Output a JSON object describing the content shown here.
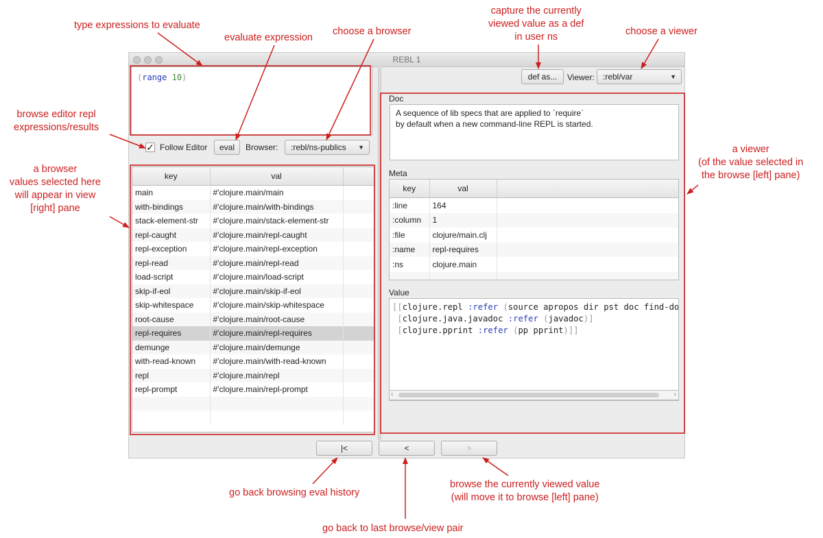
{
  "window": {
    "title": "REBL 1"
  },
  "editor": {
    "paren_open": "(",
    "fn": "range",
    "arg": "10",
    "paren_close": ")"
  },
  "controls": {
    "follow_editor_label": "Follow Editor",
    "follow_editor_checked": true,
    "eval_label": "eval",
    "browser_label": "Browser:",
    "browser_value": ":rebl/ns-publics"
  },
  "browse_table": {
    "columns": [
      "key",
      "val"
    ],
    "selected_index": 10,
    "rows": [
      [
        "main",
        "#'clojure.main/main"
      ],
      [
        "with-bindings",
        "#'clojure.main/with-bindings"
      ],
      [
        "stack-element-str",
        "#'clojure.main/stack-element-str"
      ],
      [
        "repl-caught",
        "#'clojure.main/repl-caught"
      ],
      [
        "repl-exception",
        "#'clojure.main/repl-exception"
      ],
      [
        "repl-read",
        "#'clojure.main/repl-read"
      ],
      [
        "load-script",
        "#'clojure.main/load-script"
      ],
      [
        "skip-if-eol",
        "#'clojure.main/skip-if-eol"
      ],
      [
        "skip-whitespace",
        "#'clojure.main/skip-whitespace"
      ],
      [
        "root-cause",
        "#'clojure.main/root-cause"
      ],
      [
        "repl-requires",
        "#'clojure.main/repl-requires"
      ],
      [
        "demunge",
        "#'clojure.main/demunge"
      ],
      [
        "with-read-known",
        "#'clojure.main/with-read-known"
      ],
      [
        "repl",
        "#'clojure.main/repl"
      ],
      [
        "repl-prompt",
        "#'clojure.main/repl-prompt"
      ]
    ]
  },
  "viewer_bar": {
    "def_as_label": "def as...",
    "viewer_label": "Viewer:",
    "viewer_value": ":rebl/var"
  },
  "doc": {
    "label": "Doc",
    "line1": "A sequence of lib specs that are applied to `require`",
    "line2": "by default when a new command-line REPL is started."
  },
  "meta": {
    "label": "Meta",
    "columns": [
      "key",
      "val"
    ],
    "rows": [
      [
        ":line",
        "164"
      ],
      [
        ":column",
        "1"
      ],
      [
        ":file",
        "clojure/main.clj"
      ],
      [
        ":name",
        "repl-requires"
      ],
      [
        ":ns",
        "clojure.main"
      ]
    ]
  },
  "value": {
    "label": "Value",
    "lines": [
      [
        [
          "br",
          "[["
        ],
        [
          "t",
          "clojure.repl "
        ],
        [
          "kw",
          ":refer "
        ],
        [
          "br",
          "("
        ],
        [
          "t",
          "source apropos dir pst doc find-doc"
        ],
        [
          "br",
          ")]"
        ]
      ],
      [
        [
          "t",
          " "
        ],
        [
          "br",
          "["
        ],
        [
          "t",
          "clojure.java.javadoc "
        ],
        [
          "kw",
          ":refer "
        ],
        [
          "br",
          "("
        ],
        [
          "t",
          "javadoc"
        ],
        [
          "br",
          ")]"
        ]
      ],
      [
        [
          "t",
          " "
        ],
        [
          "br",
          "["
        ],
        [
          "t",
          "clojure.pprint "
        ],
        [
          "kw",
          ":refer "
        ],
        [
          "br",
          "("
        ],
        [
          "t",
          "pp pprint"
        ],
        [
          "br",
          ")]]"
        ]
      ]
    ]
  },
  "nav": {
    "first_label": "|<",
    "back_label": "<",
    "forward_label": ">"
  },
  "annotations": {
    "type_expr": "type expressions to evaluate",
    "eval_expr": "evaluate expression",
    "choose_browser": "choose a browser",
    "capture_1": "capture the currently",
    "capture_2": "viewed value as a def",
    "capture_3": "in user ns",
    "choose_viewer": "choose a viewer",
    "browse_editor_1": "browse editor repl",
    "browse_editor_2": "expressions/results",
    "browser_1": "a browser",
    "browser_2": "values selected here",
    "browser_3": "will appear in view",
    "browser_4": "[right] pane",
    "viewer_1": "a viewer",
    "viewer_2": "(of the value selected in",
    "viewer_3": "the browse [left] pane)",
    "go_back_history": "go back browsing eval history",
    "browse_current_1": "browse the currently viewed value",
    "browse_current_2": "(will move it to browse [left] pane)",
    "go_back_pair": "go back to last browse/view pair"
  },
  "colors": {
    "annotation": "#cc1f1f",
    "selected_row": "#d3d3d3",
    "keyword": "#2a3dbb",
    "number": "#3b8c3b"
  }
}
